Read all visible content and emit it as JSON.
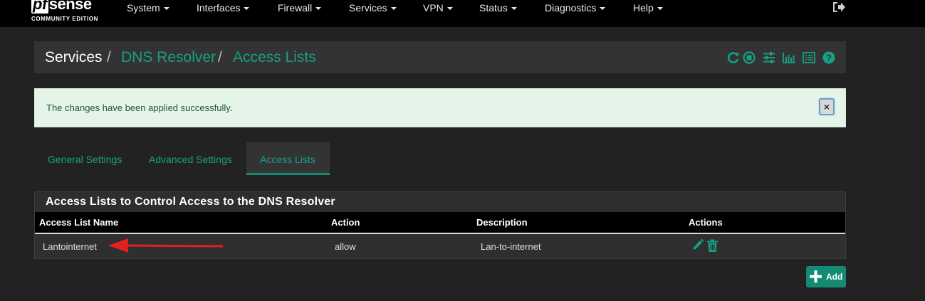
{
  "brand": {
    "logo_prefix": "pf",
    "logo_main": "sense",
    "logo_sub": "COMMUNITY EDITION"
  },
  "nav": {
    "items": [
      {
        "label": "System"
      },
      {
        "label": "Interfaces"
      },
      {
        "label": "Firewall"
      },
      {
        "label": "Services"
      },
      {
        "label": "VPN"
      },
      {
        "label": "Status"
      },
      {
        "label": "Diagnostics"
      },
      {
        "label": "Help"
      }
    ],
    "logout_icon": "logout-icon"
  },
  "breadcrumb": {
    "items": [
      {
        "label": "Services",
        "link": false
      },
      {
        "label": "DNS Resolver",
        "link": true
      },
      {
        "label": "Access Lists",
        "link": true
      }
    ],
    "separator": "/",
    "icons": [
      "reload-icon",
      "stop-icon",
      "sliders-icon",
      "bar-chart-icon",
      "log-list-icon",
      "help-icon"
    ]
  },
  "alert": {
    "message": "The changes have been applied successfully.",
    "close_label": "×"
  },
  "tabs": [
    {
      "label": "General Settings",
      "active": false
    },
    {
      "label": "Advanced Settings",
      "active": false
    },
    {
      "label": "Access Lists",
      "active": true
    }
  ],
  "panel": {
    "title": "Access Lists to Control Access to the DNS Resolver",
    "columns": [
      "Access List Name",
      "Action",
      "Description",
      "Actions"
    ],
    "rows": [
      {
        "name": "Lantointernet",
        "action": "allow",
        "description": "Lan-to-internet",
        "actions": [
          "edit-icon",
          "delete-icon"
        ]
      }
    ]
  },
  "add_button": {
    "label": "Add"
  },
  "colors": {
    "accent": "#138a74",
    "link": "#16a085",
    "background": "#222222",
    "annotation": "#e0211f",
    "alert_bg": "#e5f4e8",
    "alert_text": "#1e5631"
  }
}
